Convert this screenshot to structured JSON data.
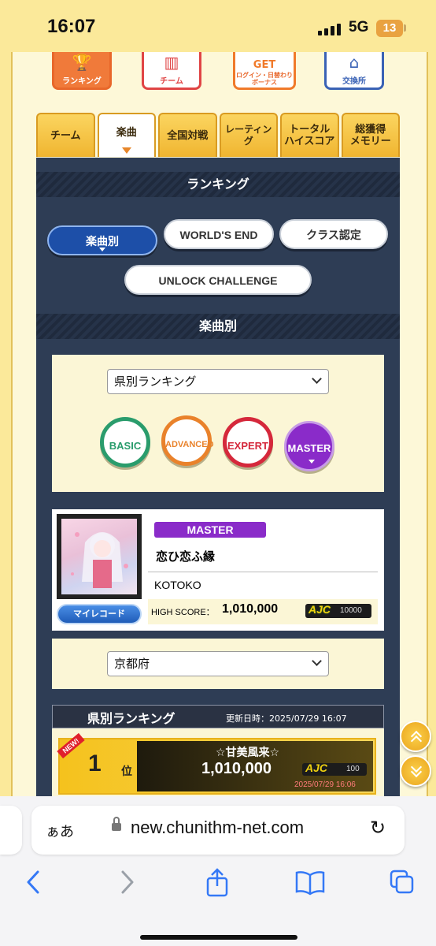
{
  "status": {
    "time": "16:07",
    "network": "5G",
    "battery": "13"
  },
  "top_nav": [
    {
      "label": "ランキング",
      "icon": "trophy-icon",
      "color": "#e8672a"
    },
    {
      "label": "チーム",
      "icon": "team-icon",
      "color": "#e04545"
    },
    {
      "label": "ログイン・日替わり\nボーナス",
      "icon": "get-bonus-icon",
      "color": "#f07a2a"
    },
    {
      "label": "交換所",
      "icon": "shop-icon",
      "color": "#3a62b5"
    }
  ],
  "tabs": [
    "チーム",
    "楽曲",
    "全国対戦",
    "レーティング",
    "トータル\nハイスコア",
    "総獲得\nメモリー"
  ],
  "ranking_header": "ランキング",
  "category_buttons": {
    "by_song": "楽曲別",
    "worlds_end": "WORLD'S END",
    "class": "クラス認定",
    "unlock": "UNLOCK CHALLENGE"
  },
  "by_song_header": "楽曲別",
  "ranking_type_select": "県別ランキング",
  "difficulties": {
    "basic": {
      "label": "BASIC",
      "color": "#2a9c6c"
    },
    "advanced": {
      "label": "ADVANCED",
      "color": "#e9822b"
    },
    "expert": {
      "label": "EXPERT",
      "color": "#d5283b"
    },
    "master": {
      "label": "MASTER",
      "color": "#8a2bc9"
    }
  },
  "song": {
    "difficulty": "MASTER",
    "title": "恋ひ恋ふ縁",
    "artist": "KOTOKO",
    "myrecord_label": "マイレコード",
    "high_score_label": "HIGH SCORE：",
    "high_score": "1,010,000",
    "lamp": "AJC",
    "lamp_value": "10000"
  },
  "prefecture_select": "京都府",
  "prefecture_ranking": {
    "title": "県別ランキング",
    "updated": "更新日時：2025/07/29 16:07",
    "entries": [
      {
        "new": "NEW!",
        "rank": "1",
        "rank_suffix": "位",
        "player": "☆甘美風来☆",
        "score": "1,010,000",
        "lamp": "AJC",
        "lamp_value": "100",
        "date": "2025/07/29 16:06"
      }
    ]
  },
  "browser": {
    "text_size": "ぁあ",
    "url": "new.chunithm-net.com"
  }
}
